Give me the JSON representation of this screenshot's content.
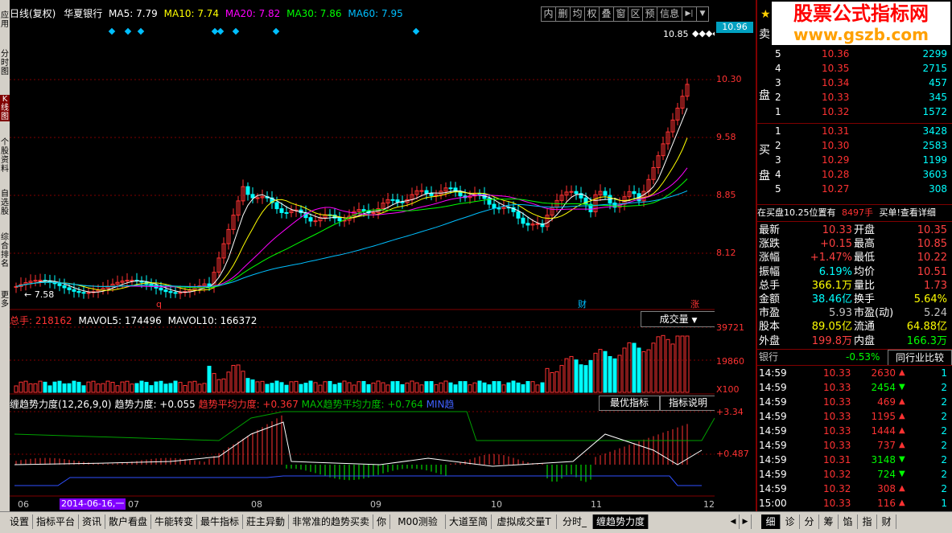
{
  "header": {
    "period": "日线(复权)",
    "stock_name": "华夏银行",
    "ma_labels": [
      {
        "text": "MA5: 7.79",
        "color": "#ffffff"
      },
      {
        "text": "MA10: 7.74",
        "color": "#ffff00"
      },
      {
        "text": "MA20: 7.82",
        "color": "#ff00ff"
      },
      {
        "text": "MA30: 7.86",
        "color": "#00ff00"
      },
      {
        "text": "MA60: 7.95",
        "color": "#00bfff"
      }
    ],
    "toolbar_buttons": [
      "内",
      "删",
      "均",
      "权",
      "叠",
      "窗",
      "区",
      "预",
      "信息"
    ]
  },
  "left_strip": [
    "应用",
    "分时图",
    "K线图",
    "个股资料",
    "自选股",
    "综合排名",
    "更多"
  ],
  "price_axis": [
    "10.96",
    "10.30",
    "9.58",
    "8.85",
    "8.12"
  ],
  "chart_annotations": {
    "high_label": "10.85",
    "low_label": "7.58",
    "events": [
      "q",
      "财",
      "涨"
    ]
  },
  "volume_panel": {
    "total_label": "总手: 218162",
    "mavol5": "MAVOL5: 174496",
    "mavol10": "MAVOL10: 166372",
    "selector": "成交量",
    "axis": [
      "39721",
      "19860",
      "X100"
    ]
  },
  "indicator_panel": {
    "title": "缠趋势力度(12,26,9,0)",
    "value": "趋势力度: +0.055",
    "avg": "趋势平均力度: +0.367",
    "max": "MAX趋势平均力度: +0.764",
    "min": "MIN趋",
    "btn_best": "最优指标",
    "btn_desc": "指标说明",
    "axis": [
      "+3.34",
      "+0.487"
    ]
  },
  "date_axis": {
    "labels": [
      "06",
      "07",
      "08",
      "09",
      "10",
      "11",
      "12"
    ],
    "cursor_date": "2014-06-16,一"
  },
  "order_book": {
    "sell_label": [
      "卖",
      "盘"
    ],
    "buy_label": [
      "买",
      "盘"
    ],
    "sells": [
      {
        "level": "5",
        "price": "10.36",
        "vol": "2299"
      },
      {
        "level": "4",
        "price": "10.35",
        "vol": "2715"
      },
      {
        "level": "3",
        "price": "10.34",
        "vol": "457"
      },
      {
        "level": "2",
        "price": "10.33",
        "vol": "345"
      },
      {
        "level": "1",
        "price": "10.32",
        "vol": "1572"
      }
    ],
    "buys": [
      {
        "level": "1",
        "price": "10.31",
        "vol": "3428"
      },
      {
        "level": "2",
        "price": "10.30",
        "vol": "2583"
      },
      {
        "level": "3",
        "price": "10.29",
        "vol": "1199"
      },
      {
        "level": "4",
        "price": "10.28",
        "vol": "3603"
      },
      {
        "level": "5",
        "price": "10.27",
        "vol": "308"
      }
    ],
    "bid_info": "在买盘10.25位置有",
    "bid_qty": "8497手",
    "bid_link": "买单!查看详细"
  },
  "quote": [
    {
      "l": "最新",
      "v": "10.33",
      "vc": "#ff4040",
      "l2": "开盘",
      "v2": "10.35",
      "v2c": "#ff4040"
    },
    {
      "l": "涨跌",
      "v": "+0.15",
      "vc": "#ff4040",
      "l2": "最高",
      "v2": "10.85",
      "v2c": "#ff4040"
    },
    {
      "l": "涨幅",
      "v": "+1.47%",
      "vc": "#ff4040",
      "l2": "最低",
      "v2": "10.22",
      "v2c": "#ff4040"
    },
    {
      "l": "振幅",
      "v": "6.19%",
      "vc": "#00ffff",
      "l2": "均价",
      "v2": "10.51",
      "v2c": "#ff4040"
    },
    {
      "l": "总手",
      "v": "366.1万",
      "vc": "#ffff00",
      "l2": "量比",
      "v2": "1.73",
      "v2c": "#ff4040"
    },
    {
      "l": "金额",
      "v": "38.46亿",
      "vc": "#00ffff",
      "l2": "换手",
      "v2": "5.64%",
      "v2c": "#ffff00"
    },
    {
      "l": "市盈",
      "v": "5.93",
      "vc": "#c0c0c0",
      "l2": "市盈(动)",
      "v2": "5.24",
      "v2c": "#c0c0c0"
    },
    {
      "l": "股本",
      "v": "89.05亿",
      "vc": "#ffff00",
      "l2": "流通",
      "v2": "64.88亿",
      "v2c": "#ffff00"
    },
    {
      "l": "外盘",
      "v": "199.8万",
      "vc": "#ff4040",
      "l2": "内盘",
      "v2": "166.3万",
      "v2c": "#00ff00"
    }
  ],
  "sector": {
    "name": "银行",
    "change": "-0.53%",
    "btn": "同行业比较"
  },
  "ticks": [
    {
      "t": "14:59",
      "p": "10.33",
      "v": "2630",
      "dir": "up",
      "n": "1"
    },
    {
      "t": "14:59",
      "p": "10.33",
      "v": "2454",
      "dir": "down",
      "n": "2"
    },
    {
      "t": "14:59",
      "p": "10.33",
      "v": "469",
      "dir": "up",
      "n": "2"
    },
    {
      "t": "14:59",
      "p": "10.33",
      "v": "1195",
      "dir": "up",
      "n": "2"
    },
    {
      "t": "14:59",
      "p": "10.33",
      "v": "1444",
      "dir": "up",
      "n": "2"
    },
    {
      "t": "14:59",
      "p": "10.33",
      "v": "737",
      "dir": "up",
      "n": "2"
    },
    {
      "t": "14:59",
      "p": "10.31",
      "v": "3148",
      "dir": "down",
      "n": "2"
    },
    {
      "t": "14:59",
      "p": "10.32",
      "v": "724",
      "dir": "down",
      "n": "2"
    },
    {
      "t": "14:59",
      "p": "10.32",
      "v": "308",
      "dir": "up",
      "n": "2"
    },
    {
      "t": "15:00",
      "p": "10.33",
      "v": "116",
      "dir": "up",
      "n": "1"
    }
  ],
  "watermark": {
    "line1": "股票公式指标网",
    "line2": "www.gszb.com"
  },
  "bottom_tabs": [
    "设置",
    "指标平台",
    "资讯",
    "散户看盘",
    "牛能转变",
    "最牛指标",
    "莊主异動",
    "非常准的趋势买卖",
    "你",
    "M00测验",
    "大道至简",
    "虚拟成交量T",
    "分时_",
    "缠趋势力度"
  ],
  "right_tabs": [
    "细",
    "诊",
    "分",
    "筹",
    "馅",
    "指",
    "财"
  ],
  "colors": {
    "up": "#ff3232",
    "down": "#00ffff",
    "grid": "#800000",
    "axis_text": "#ff3232"
  }
}
